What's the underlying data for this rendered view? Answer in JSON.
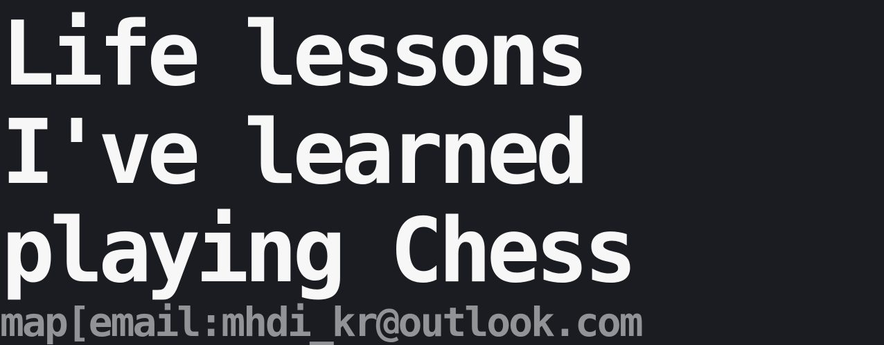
{
  "title": {
    "lines": [
      "Life lessons",
      "I've learned",
      "playing Chess"
    ]
  },
  "meta": {
    "text": "map[email:mhdi_kr@outlook.com"
  },
  "colors": {
    "background": "#1b1c21",
    "title": "#f7f7f7",
    "meta": "#929396"
  }
}
